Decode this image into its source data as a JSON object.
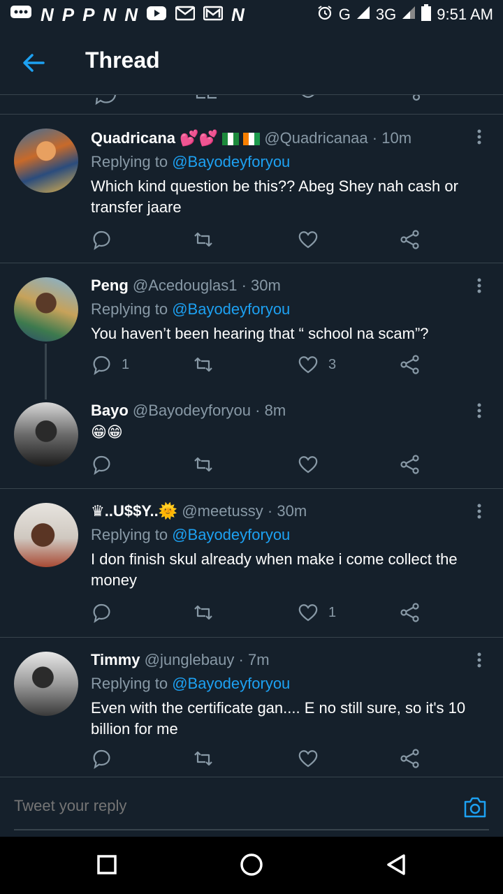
{
  "status_bar": {
    "left_icons": [
      "message-icon",
      "n",
      "p",
      "p",
      "n",
      "n",
      "youtube-icon",
      "mail-icon",
      "mail-icon",
      "n"
    ],
    "network": "G",
    "network2": "3G",
    "time": "9:51 AM"
  },
  "header": {
    "title": "Thread"
  },
  "tweets": [
    {
      "name": "Quadricana",
      "emoji": "💕💕",
      "handle": "@Quadricanaa",
      "time": "10m",
      "replying_prefix": "Replying to",
      "replying_to": "@Bayodeyforyou",
      "text": "Which kind question be this?? Abeg Shey nah cash or transfer jaare",
      "reply_count": "",
      "like_count": ""
    },
    {
      "name": "Peng",
      "emoji": "",
      "handle": "@Acedouglas1",
      "time": "30m",
      "replying_prefix": "Replying to",
      "replying_to": "@Bayodeyforyou",
      "text": "You haven’t been hearing that “ school na scam”?",
      "reply_count": "1",
      "like_count": "3"
    },
    {
      "name": "Bayo",
      "emoji": "",
      "handle": "@Bayodeyforyou",
      "time": "8m",
      "replying_prefix": "",
      "replying_to": "",
      "text": "😁😁",
      "reply_count": "",
      "like_count": ""
    },
    {
      "name": "♛..U$$Y..🌞",
      "emoji": "",
      "handle": "@meetussy",
      "time": "30m",
      "replying_prefix": "Replying to",
      "replying_to": "@Bayodeyforyou",
      "text": "I don finish skul already when make i come collect the money",
      "reply_count": "",
      "like_count": "1"
    },
    {
      "name": "Timmy",
      "emoji": "",
      "handle": "@junglebauy",
      "time": "7m",
      "replying_prefix": "Replying to",
      "replying_to": "@Bayodeyforyou",
      "text": "Even with the certificate gan.... E no still sure, so it's 10 billion for me",
      "reply_count": "",
      "like_count": ""
    }
  ],
  "composer": {
    "placeholder": "Tweet your reply"
  },
  "colors": {
    "background": "#15202b",
    "accent": "#1da1f2",
    "muted": "#8899a6",
    "divider": "#38444d"
  }
}
